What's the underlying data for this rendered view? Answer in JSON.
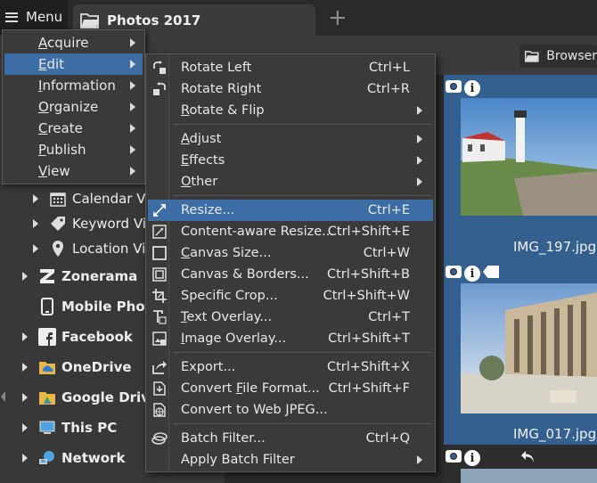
{
  "topbar": {
    "menu_label": "Menu",
    "tab_title": "Photos 2017",
    "new_tab_label": "+"
  },
  "toolbar": {
    "browser_label": "Browser"
  },
  "leftnav": {
    "items": [
      {
        "label": "Calendar View",
        "icon": "calendar-icon"
      },
      {
        "label": "Keyword View",
        "icon": "tag-icon"
      },
      {
        "label": "Location View",
        "icon": "location-icon"
      },
      {
        "label": "Zonerama",
        "icon": "zonerama-icon"
      },
      {
        "label": "Mobile Photos",
        "icon": "phone-icon"
      },
      {
        "label": "Facebook",
        "icon": "facebook-icon"
      },
      {
        "label": "OneDrive",
        "icon": "onedrive-icon"
      },
      {
        "label": "Google Drive",
        "icon": "google-drive-icon"
      },
      {
        "label": "This PC",
        "icon": "computer-icon"
      },
      {
        "label": "Network",
        "icon": "network-icon"
      }
    ]
  },
  "thumbnails": [
    {
      "filename": "IMG_197.jpg"
    },
    {
      "filename": "IMG_017.jpg"
    }
  ],
  "main_menu": {
    "items": [
      {
        "label": "Acquire",
        "underline": "A",
        "rest": "cquire"
      },
      {
        "label": "Edit",
        "underline": "E",
        "rest": "dit"
      },
      {
        "label": "Information",
        "underline": "I",
        "rest": "nformation"
      },
      {
        "label": "Organize",
        "underline": "O",
        "rest": "rganize"
      },
      {
        "label": "Create",
        "underline": "C",
        "rest": "reate"
      },
      {
        "label": "Publish",
        "underline": "P",
        "rest": "ublish"
      },
      {
        "label": "View",
        "underline": "V",
        "rest": "iew"
      }
    ],
    "active": "Edit"
  },
  "edit_menu": {
    "items": [
      {
        "pre": "",
        "u": "",
        "post": "Rotate Left",
        "shortcut": "Ctrl+L",
        "icon": "rotate-left-icon"
      },
      {
        "pre": "",
        "u": "",
        "post": "Rotate Right",
        "shortcut": "Ctrl+R",
        "icon": "rotate-right-icon"
      },
      {
        "pre": "",
        "u": "R",
        "post": "otate & Flip",
        "shortcut": "",
        "icon": ""
      },
      {
        "pre": "",
        "u": "A",
        "post": "djust",
        "shortcut": "",
        "icon": ""
      },
      {
        "pre": "",
        "u": "E",
        "post": "ffects",
        "shortcut": "",
        "icon": ""
      },
      {
        "pre": "",
        "u": "O",
        "post": "ther",
        "shortcut": "",
        "icon": ""
      },
      {
        "pre": "",
        "u": "",
        "post": "Resize...",
        "shortcut": "Ctrl+E",
        "icon": "resize-icon"
      },
      {
        "pre": "",
        "u": "",
        "post": "Content-aware Resize...",
        "shortcut": "Ctrl+Shift+E",
        "icon": "content-aware-resize-icon"
      },
      {
        "pre": "",
        "u": "C",
        "post": "anvas Size...",
        "shortcut": "Ctrl+W",
        "icon": "canvas-size-icon"
      },
      {
        "pre": "",
        "u": "",
        "post": "Canvas & Borders...",
        "shortcut": "Ctrl+Shift+B",
        "icon": "canvas-borders-icon"
      },
      {
        "pre": "",
        "u": "",
        "post": "Specific Crop...",
        "shortcut": "Ctrl+Shift+W",
        "icon": "crop-icon"
      },
      {
        "pre": "",
        "u": "T",
        "post": "ext Overlay...",
        "shortcut": "Ctrl+T",
        "icon": "text-overlay-icon"
      },
      {
        "pre": "",
        "u": "I",
        "post": "mage Overlay...",
        "shortcut": "Ctrl+Shift+T",
        "icon": "image-overlay-icon"
      },
      {
        "pre": "",
        "u": "",
        "post": "Export...",
        "shortcut": "Ctrl+Shift+X",
        "icon": "export-icon"
      },
      {
        "pre": "Convert ",
        "u": "F",
        "post": "ile Format...",
        "shortcut": "Ctrl+Shift+F",
        "icon": "convert-format-icon"
      },
      {
        "pre": "",
        "u": "",
        "post": "Convert to Web JPEG...",
        "shortcut": "",
        "icon": "web-jpeg-icon"
      },
      {
        "pre": "",
        "u": "",
        "post": "Batch Filter...",
        "shortcut": "Ctrl+Q",
        "icon": "batch-filter-icon"
      },
      {
        "pre": "",
        "u": "",
        "post": "Apply Batch Filter",
        "shortcut": "",
        "icon": ""
      }
    ],
    "active": "Resize..."
  },
  "colors": {
    "highlight": "#3c6ea5",
    "thumb_bg": "#33608f",
    "menu_bg": "#3a3a3a"
  }
}
